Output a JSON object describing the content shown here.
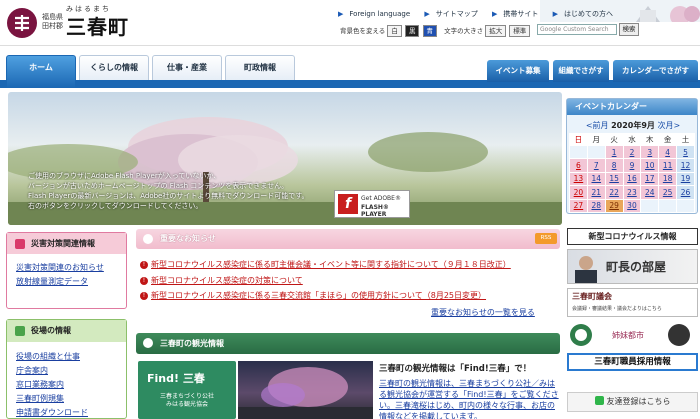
{
  "header": {
    "prefecture": "福島県",
    "district": "田村郡",
    "town_kana": "みはるまち",
    "town_name": "三春町",
    "utility_links": [
      "Foreign language",
      "サイトマップ",
      "携帯サイト",
      "はじめての方へ"
    ],
    "bg_color_label": "背景色を変える",
    "bg_options": [
      "白",
      "黒",
      "青"
    ],
    "font_size_label": "文字の大きさ",
    "font_options": [
      "拡大",
      "標準"
    ],
    "search_placeholder": "Google Custom Search",
    "search_button": "検索"
  },
  "nav": {
    "tabs": [
      "ホーム",
      "くらしの情報",
      "仕事・産業",
      "町政情報"
    ],
    "right_tabs": [
      "イベント募集",
      "組織でさがす",
      "カレンダーでさがす"
    ]
  },
  "hero": {
    "notice_lines": [
      "ご使用のブラウザにAdobe Flash Playerが入っていないか、",
      "バージョンが古いためホームページトップの Flash コンテンツを表示できません。",
      "Flash Playerの最新バージョンは、Adobe社のサイトより無料でダウンロード可能です。",
      "右のボタンをクリックしてダウンロードしてください。"
    ],
    "flash_badge_top": "Get ADOBE®",
    "flash_badge_bottom": "FLASH® PLAYER"
  },
  "calendar": {
    "title": "イベントカレンダー",
    "prev": "<前月",
    "month": "2020年9月",
    "next": "次月>",
    "weekdays": [
      "日",
      "月",
      "火",
      "水",
      "木",
      "金",
      "土"
    ],
    "weeks": [
      [
        "",
        "",
        "1",
        "2",
        "3",
        "4",
        "5"
      ],
      [
        "6",
        "7",
        "8",
        "9",
        "10",
        "11",
        "12"
      ],
      [
        "13",
        "14",
        "15",
        "16",
        "17",
        "18",
        "19"
      ],
      [
        "20",
        "21",
        "22",
        "23",
        "24",
        "25",
        "26"
      ],
      [
        "27",
        "28",
        "29",
        "30",
        "",
        "",
        ""
      ]
    ],
    "today": "29"
  },
  "left": {
    "disaster_title": "災害対策関連情報",
    "disaster_links": [
      "災害対策関連のお知らせ",
      "放射線量測定データ"
    ],
    "office_title": "役場の情報",
    "office_links": [
      "役場の組織と仕事",
      "庁舎案内",
      "窓口業務案内",
      "三春町例規集",
      "申請書ダウンロード"
    ]
  },
  "news": {
    "title": "重要なお知らせ",
    "rss": "RSS",
    "items": [
      "新型コロナウイルス感染症に係る町主催会議・イベント等に関する指針について（９月１８日改正）",
      "新型コロナウイルス感染症の対策について",
      "新型コロナウイルス感染症に係る三春交流館「まほら」の使用方針について（8月25日変更）"
    ],
    "more": "重要なお知らせの一覧を見る"
  },
  "tourism": {
    "title": "三春町の観光情報",
    "card_title": "Find! 三春",
    "card_org": "三春まちづくり公社",
    "card_assoc": "みはる観光協会",
    "headline": "三春町の観光情報は「Find!三春」で！",
    "body": "三春町の観光情報は、三春まちづくり公社／みはる観光協会が運営する「Find!三春」をご覧ください。三春滝桜はじめ、町内の様々な行事、お店の情報などを掲載しています。"
  },
  "right": {
    "covid": "新型コロナウイルス情報",
    "mayor": "町長の部屋",
    "council": "三春町議会",
    "council_sub": "会議録・審議結果・議会だよりはこちら",
    "sister_city": "姉妹都市",
    "staff": "三春町職員採用情報",
    "friends": "友達登録はこちら"
  }
}
